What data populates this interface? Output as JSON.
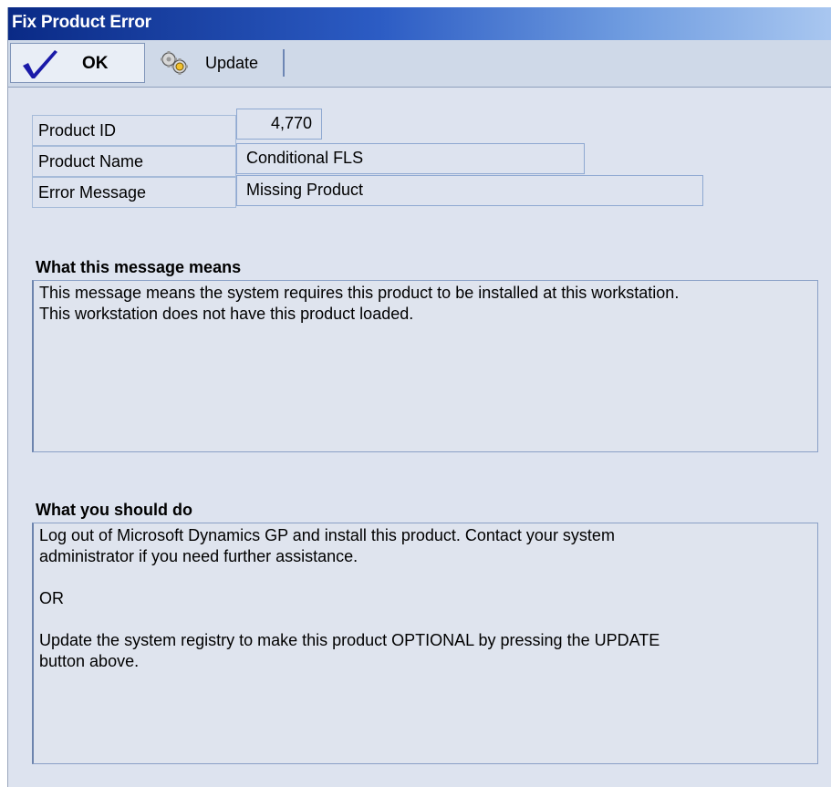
{
  "window": {
    "title": "Fix Product Error"
  },
  "toolbar": {
    "ok_label": "OK",
    "update_label": "Update"
  },
  "fields": {
    "product_id": {
      "label": "Product ID",
      "value": "4,770"
    },
    "product_name": {
      "label": "Product Name",
      "value": "Conditional FLS"
    },
    "error_message": {
      "label": "Error Message",
      "value": "Missing Product"
    }
  },
  "meaning": {
    "heading": "What this message means",
    "lines": [
      "This message means the system requires this product to be installed at this workstation.",
      "This workstation does not have this product loaded."
    ]
  },
  "action": {
    "heading": "What you should do",
    "lines": [
      "Log out of Microsoft Dynamics GP and install this product.  Contact your system",
      "administrator if you need further assistance.",
      "OR",
      "Update the system registry to make this product OPTIONAL by pressing the UPDATE",
      "button above."
    ]
  },
  "colors": {
    "titlebar_start": "#0a2a86",
    "titlebar_end": "#a9c7f0",
    "window_bg": "#dde3ef",
    "field_border": "#8ea8d1"
  },
  "icons": {
    "ok": "checkmark-icon",
    "update": "gears-icon"
  }
}
